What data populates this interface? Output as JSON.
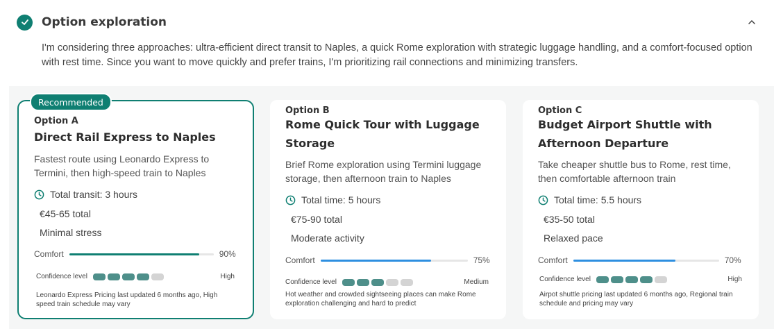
{
  "header": {
    "title": "Option exploration",
    "accent": "#0f7f72"
  },
  "intro": "I'm considering three approaches: ultra-efficient direct transit to Naples, a quick Rome exploration with strategic luggage handling, and a comfort-focused option with rest time. Since you want to move quickly and prefer trains, I'm prioritizing rail connections and minimizing transfers.",
  "options": [
    {
      "badge": "Recommended",
      "label": "Option A",
      "name": "Direct Rail Express to Naples",
      "description": "Fastest route using Leonardo Express to Termini, then high-speed train to Naples",
      "time": "Total transit: 3 hours",
      "cost": "€45-65 total",
      "effort": "Minimal stress",
      "comfort_label": "Comfort",
      "comfort_value": 0.9,
      "comfort_text": "90%",
      "comfort_color": "#0f7f72",
      "confidence_label": "Confidence level",
      "confidence_segments": 4,
      "confidence_total": 5,
      "confidence_text": "High",
      "note": "Leonardo Express Pricing last updated 6 months ago, High speed train schedule may vary"
    },
    {
      "label": "Option B",
      "name": "Rome Quick Tour with Luggage Storage",
      "description": "Brief Rome exploration using Termini luggage storage, then afternoon train to Naples",
      "time": "Total time: 5 hours",
      "cost": "€75-90 total",
      "effort": "Moderate activity",
      "comfort_label": "Comfort",
      "comfort_value": 0.75,
      "comfort_text": "75%",
      "comfort_color": "#2e8fe0",
      "confidence_label": "Confidence level",
      "confidence_segments": 3,
      "confidence_total": 5,
      "confidence_text": "Medium",
      "note": "Hot weather and crowded sightseeing places can make Rome exploration challenging and hard to predict"
    },
    {
      "label": "Option C",
      "name": "Budget Airport Shuttle with Afternoon Departure",
      "description": "Take cheaper shuttle bus to Rome, rest time, then comfortable afternoon train",
      "time": "Total time: 5.5 hours",
      "cost": "€35-50 total",
      "effort": "Relaxed pace",
      "comfort_label": "Comfort",
      "comfort_value": 0.7,
      "comfort_text": "70%",
      "comfort_color": "#2e8fe0",
      "confidence_label": "Confidence level",
      "confidence_segments": 4,
      "confidence_total": 5,
      "confidence_text": "High",
      "note": "Airpot shuttle pricing last updated 6 months ago, Regional train schedule and pricing may vary"
    }
  ]
}
